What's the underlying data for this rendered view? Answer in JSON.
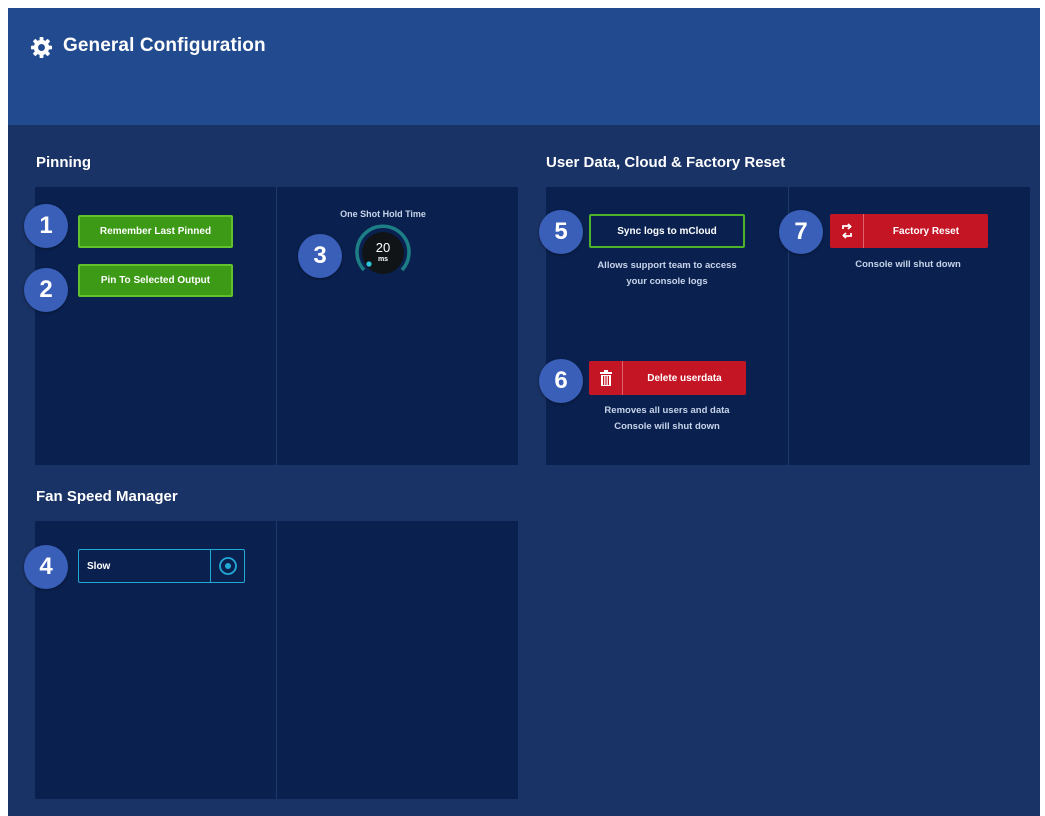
{
  "header": {
    "title": "General Configuration",
    "icon": "gear-icon"
  },
  "pinning": {
    "title": "Pinning",
    "remember_last_pinned": "Remember Last Pinned",
    "pin_to_selected_output": "Pin To Selected Output",
    "one_shot_hold_time": {
      "label": "One Shot Hold Time",
      "value": "20",
      "unit": "ms"
    }
  },
  "user_data": {
    "title": "User Data, Cloud & Factory Reset",
    "sync_logs": {
      "label": "Sync logs to mCloud",
      "caption_line1": "Allows support team to access",
      "caption_line2": "your console logs"
    },
    "delete_userdata": {
      "label": "Delete userdata",
      "icon": "trash-icon",
      "caption_line1": "Removes all users and data",
      "caption_line2": "Console will shut down"
    },
    "factory_reset": {
      "label": "Factory Reset",
      "icon": "reset-icon",
      "caption": "Console will shut down"
    }
  },
  "fan_speed": {
    "title": "Fan Speed Manager",
    "selected": "Slow"
  },
  "badges": [
    "1",
    "2",
    "3",
    "4",
    "5",
    "6",
    "7"
  ],
  "colors": {
    "background": "#1a3366",
    "header": "#224a8e",
    "panel": "#0a2150",
    "green": "#3c9a16",
    "red": "#c41525",
    "cyan": "#22a9d6",
    "badge": "#3a5fb8"
  }
}
